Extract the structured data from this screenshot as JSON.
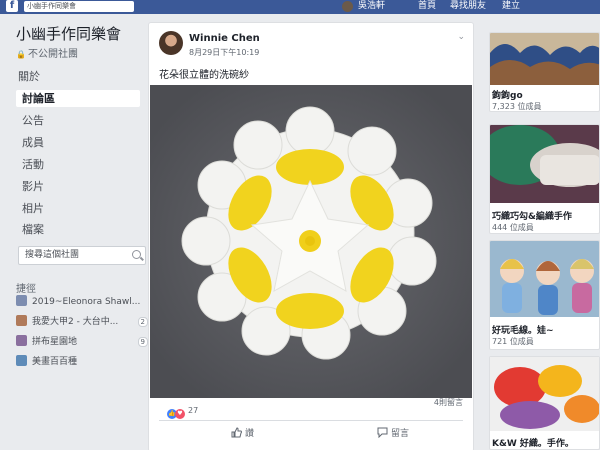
{
  "topbar": {
    "logo": "f",
    "search_text": "小幽手作同樂會",
    "user_name": "吳浩軒",
    "nav": [
      "首頁",
      "尋找朋友",
      "建立"
    ]
  },
  "group": {
    "name": "小幽手作同樂會",
    "privacy": "不公開社團",
    "privacy_icon": "lock-icon"
  },
  "sidebar": {
    "items": [
      {
        "label": "關於",
        "active": false
      },
      {
        "label": "討論區",
        "active": true
      },
      {
        "label": "公告",
        "active": false
      },
      {
        "label": "成員",
        "active": false
      },
      {
        "label": "活動",
        "active": false
      },
      {
        "label": "影片",
        "active": false
      },
      {
        "label": "相片",
        "active": false
      },
      {
        "label": "檔案",
        "active": false
      }
    ],
    "search_placeholder": "搜尋這個社團",
    "shortcuts_title": "捷徑",
    "shortcuts": [
      {
        "label": "2019~Eleonora Shawl...",
        "count": "",
        "color": "#7d8db0"
      },
      {
        "label": "我愛大甲2 - 大台中...",
        "count": "2",
        "color": "#b07a5a"
      },
      {
        "label": "拼布星園地",
        "count": "9",
        "color": "#8a6f9e"
      },
      {
        "label": "美畫百百種",
        "count": "",
        "color": "#5e8bb8"
      }
    ]
  },
  "post": {
    "author": "Winnie Chen",
    "time": "8月29日下午10:19",
    "text": "花朵很立體的洗碗紗",
    "reaction_count": "27",
    "comments": "4則留言",
    "like_label": "讚",
    "comment_label": "留言"
  },
  "suggestions": [
    {
      "title": "鉤鉤go",
      "members": "7,323 位成員"
    },
    {
      "title": "巧織巧勾&編織手作",
      "members": "444 位成員"
    },
    {
      "title": "好玩毛線。娃~",
      "members": "721 位成員"
    },
    {
      "title": "K&W 好織。手作。",
      "members": ""
    }
  ]
}
